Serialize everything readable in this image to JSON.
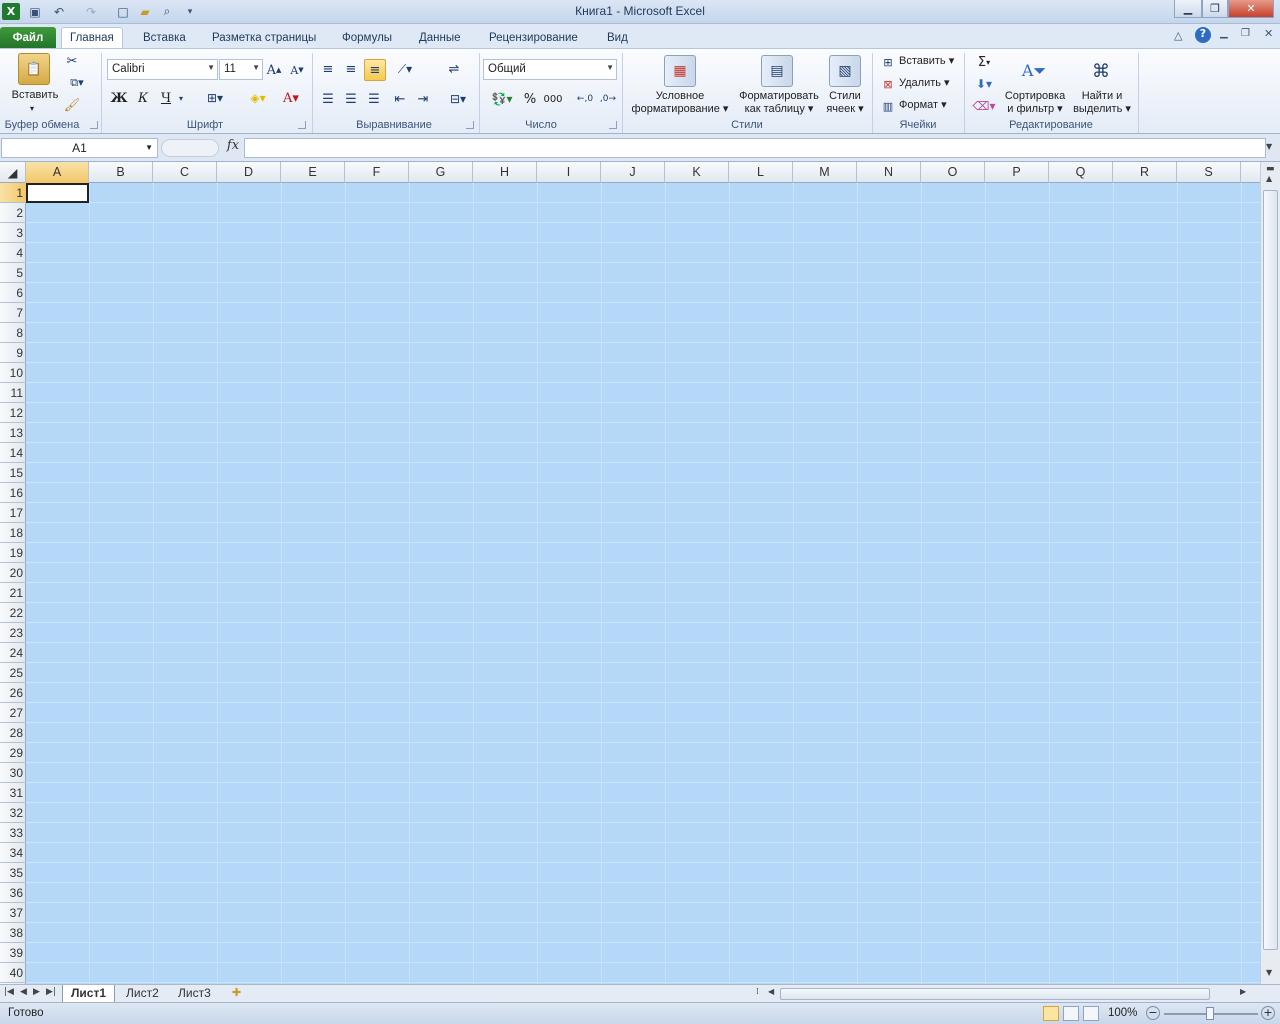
{
  "window": {
    "title": "Книга1  -  Microsoft Excel",
    "controls": [
      "minimize",
      "restore",
      "close"
    ]
  },
  "quick_access": {
    "icons": [
      "excel-logo-icon",
      "save-icon",
      "undo-icon",
      "redo-icon",
      "new-icon",
      "open-icon",
      "print-preview-icon",
      "customize-icon"
    ]
  },
  "ribbon_tabs": {
    "file": "Файл",
    "items": [
      "Главная",
      "Вставка",
      "Разметка страницы",
      "Формулы",
      "Данные",
      "Рецензирование",
      "Вид"
    ],
    "active": "Главная"
  },
  "ribbon": {
    "clipboard": {
      "paste": "Вставить",
      "label": "Буфер обмена"
    },
    "font": {
      "name": "Calibri",
      "size": "11",
      "bold": "Ж",
      "italic": "К",
      "underline": "Ч",
      "label": "Шрифт"
    },
    "alignment": {
      "label": "Выравнивание"
    },
    "number": {
      "format": "Общий",
      "percent": "%",
      "thousands": "000",
      "label": "Число"
    },
    "styles": {
      "conditional": [
        "Условное",
        "форматирование"
      ],
      "as_table": [
        "Форматировать",
        "как таблицу"
      ],
      "cell_styles": [
        "Стили",
        "ячеек"
      ],
      "label": "Стили"
    },
    "cells": {
      "insert": "Вставить",
      "delete": "Удалить",
      "format": "Формат",
      "label": "Ячейки"
    },
    "editing": {
      "sum": "Σ",
      "sort": [
        "Сортировка",
        "и фильтр"
      ],
      "find": [
        "Найти и",
        "выделить"
      ],
      "label": "Редактирование"
    }
  },
  "formula_bar": {
    "name_box": "A1",
    "fx": "fx",
    "value": ""
  },
  "grid": {
    "columns": [
      "A",
      "B",
      "C",
      "D",
      "E",
      "F",
      "G",
      "H",
      "I",
      "J",
      "K",
      "L",
      "M",
      "N",
      "O",
      "P",
      "Q",
      "R",
      "S"
    ],
    "rows": [
      "1",
      "2",
      "3",
      "4",
      "5",
      "6",
      "7",
      "8",
      "9",
      "10",
      "11",
      "12",
      "13",
      "14",
      "15",
      "16",
      "17",
      "18",
      "19",
      "20",
      "21",
      "22",
      "23",
      "24",
      "25",
      "26",
      "27",
      "28",
      "29",
      "30",
      "31",
      "32",
      "33",
      "34",
      "35",
      "36",
      "37",
      "38",
      "39",
      "40"
    ],
    "active_cell": "A1",
    "selection_color": "#b5d8f9"
  },
  "sheets": {
    "tabs": [
      "Лист1",
      "Лист2",
      "Лист3"
    ],
    "active": "Лист1"
  },
  "status": {
    "text": "Готово",
    "zoom": "100%"
  }
}
